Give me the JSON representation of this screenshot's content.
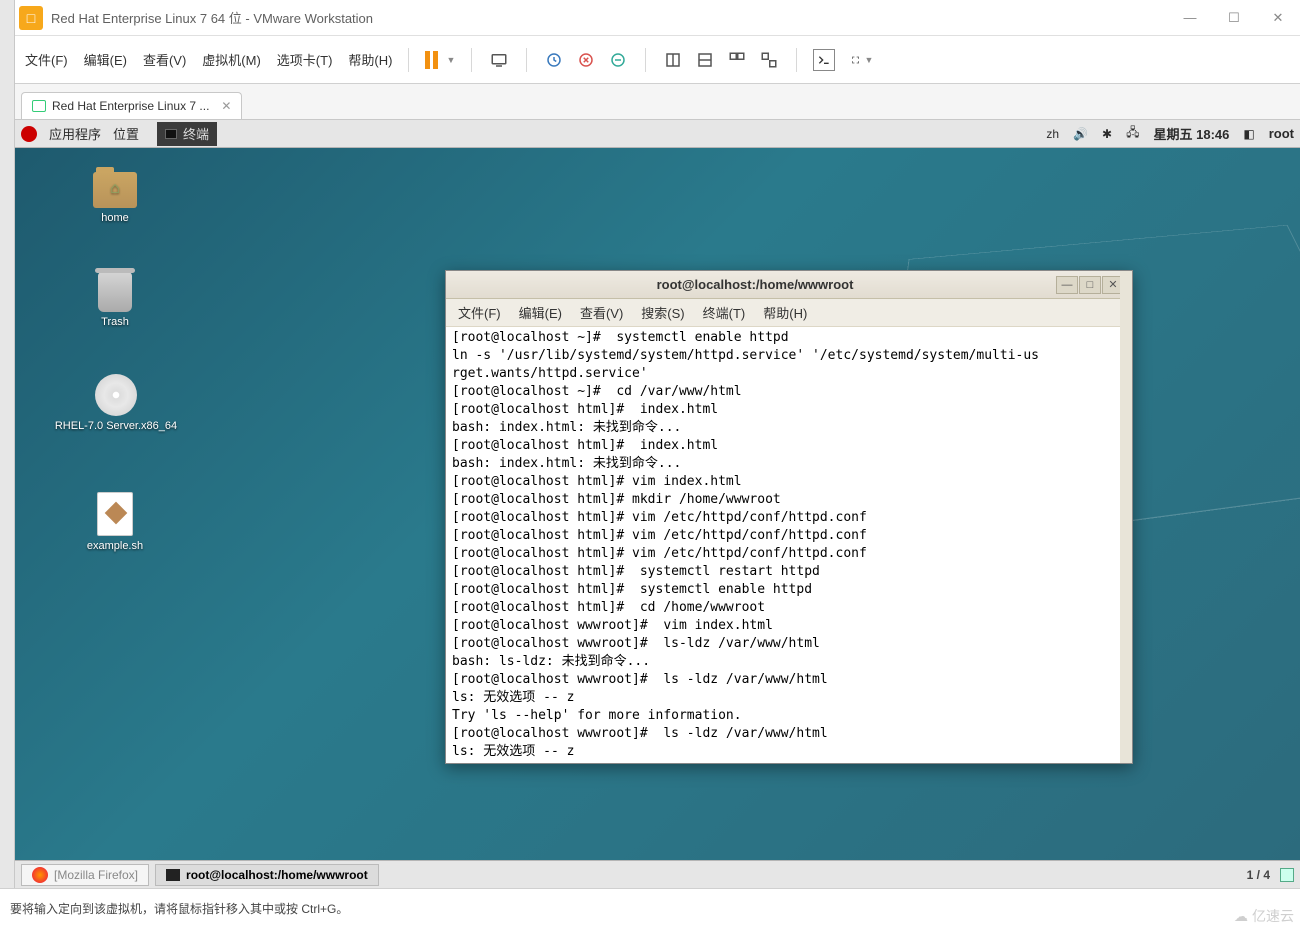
{
  "vm": {
    "title": "Red Hat Enterprise Linux 7 64 位 - VMware Workstation",
    "menu": [
      "文件(F)",
      "编辑(E)",
      "查看(V)",
      "虚拟机(M)",
      "选项卡(T)",
      "帮助(H)"
    ],
    "tab": "Red Hat Enterprise Linux 7 ...",
    "status": "要将输入定向到该虚拟机，请将鼠标指针移入其中或按 Ctrl+G。"
  },
  "guest_panel": {
    "apps": "应用程序",
    "places": "位置",
    "terminal_app": "终端",
    "lang": "zh",
    "clock": "星期五 18:46",
    "user": "root"
  },
  "desktop": {
    "home": "home",
    "trash": "Trash",
    "cd": "RHEL-7.0 Server.x86_64",
    "file": "example.sh"
  },
  "terminal": {
    "title": "root@localhost:/home/wwwroot",
    "menu": [
      "文件(F)",
      "编辑(E)",
      "查看(V)",
      "搜索(S)",
      "终端(T)",
      "帮助(H)"
    ],
    "content": "[root@localhost ~]#  systemctl enable httpd\nln -s '/usr/lib/systemd/system/httpd.service' '/etc/systemd/system/multi-us\nrget.wants/httpd.service'\n[root@localhost ~]#  cd /var/www/html\n[root@localhost html]#  index.html\nbash: index.html: 未找到命令...\n[root@localhost html]#  index.html\nbash: index.html: 未找到命令...\n[root@localhost html]# vim index.html\n[root@localhost html]# mkdir /home/wwwroot\n[root@localhost html]# vim /etc/httpd/conf/httpd.conf\n[root@localhost html]# vim /etc/httpd/conf/httpd.conf\n[root@localhost html]# vim /etc/httpd/conf/httpd.conf\n[root@localhost html]#  systemctl restart httpd\n[root@localhost html]#  systemctl enable httpd\n[root@localhost html]#  cd /home/wwwroot\n[root@localhost wwwroot]#  vim index.html\n[root@localhost wwwroot]#  ls-ldz /var/www/html\nbash: ls-ldz: 未找到命令...\n[root@localhost wwwroot]#  ls -ldz /var/www/html\nls: 无效选项 -- z\nTry 'ls --help' for more information.\n[root@localhost wwwroot]#  ls -ldz /var/www/html\nls: 无效选项 -- z"
  },
  "taskbar": {
    "firefox": "[Mozilla Firefox]",
    "terminal": "root@localhost:/home/wwwroot",
    "workspace": "1 / 4"
  },
  "watermark": "亿速云"
}
